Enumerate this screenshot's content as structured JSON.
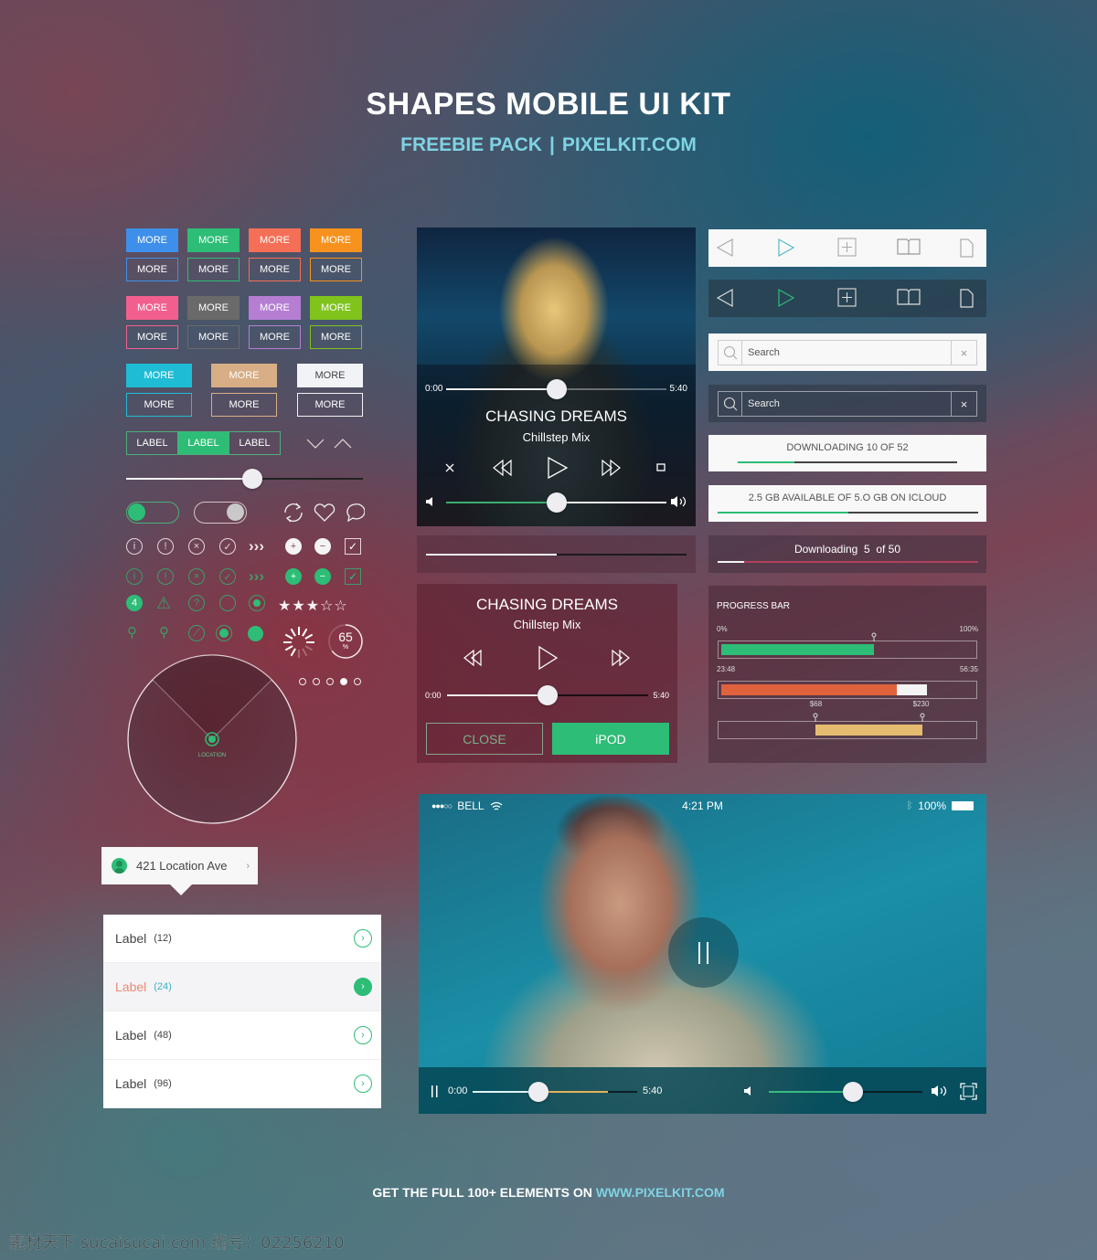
{
  "header": {
    "title": "SHAPES MOBILE UI KIT",
    "subtitle_left": "FREEBIE PACK",
    "subtitle_sep": "|",
    "subtitle_right": "PIXELKIT.COM"
  },
  "buttons": {
    "label": "MORE",
    "colors": [
      "#3d8fea",
      "#2dbd76",
      "#f56f56",
      "#f7921e",
      "#f25f8e",
      "#6a6a6a",
      "#b57ed3",
      "#7fc31c",
      "#1fbcd6",
      "#d7ae85",
      "#f2f3f6"
    ]
  },
  "segmented": {
    "items": [
      "LABEL",
      "LABEL",
      "LABEL"
    ],
    "active_index": 1
  },
  "slider": {
    "value": 0.5
  },
  "toggles": [
    {
      "state": "on"
    },
    {
      "state": "off"
    }
  ],
  "badge": {
    "count": "4"
  },
  "rating": {
    "value": 3,
    "max": 5
  },
  "percent_ring": {
    "value": "65",
    "unit": "%",
    "fraction": 0.65
  },
  "pagination": {
    "pages": 5,
    "active": 4
  },
  "radar": {
    "label": "LOCATION"
  },
  "location_tooltip": {
    "text": "421 Location Ave"
  },
  "list": {
    "items": [
      {
        "label": "Label",
        "count": "(12)",
        "active": false
      },
      {
        "label": "Label",
        "count": "(24)",
        "active": true
      },
      {
        "label": "Label",
        "count": "(48)",
        "active": false
      },
      {
        "label": "Label",
        "count": "(96)",
        "active": false
      }
    ]
  },
  "player_photo": {
    "time_start": "0:00",
    "time_end": "5:40",
    "progress": 0.5,
    "title": "CHASING DREAMS",
    "subtitle": "Chillstep Mix",
    "volume": 0.5
  },
  "simple_progress": {
    "value": 0.5
  },
  "player_compact": {
    "title": "CHASING DREAMS",
    "subtitle": "Chillstep Mix",
    "time_start": "0:00",
    "time_end": "5:40",
    "progress": 0.5,
    "close_label": "CLOSE",
    "ipod_label": "iPOD"
  },
  "search": {
    "placeholder": "Search"
  },
  "downloads": {
    "light": {
      "text": "DOWNLOADING 10 OF 52",
      "progress": 0.26
    },
    "icloud": {
      "text": "2.5 GB AVAILABLE OF 5.O GB ON ICLOUD",
      "progress": 0.5
    },
    "dark": {
      "text": "Downloading  5  of 50",
      "progress": 0.1
    }
  },
  "progress_panel": {
    "title": "PROGRESS BAR",
    "bar1": {
      "min_label": "0%",
      "max_label": "100%",
      "value": 0.6
    },
    "bar2": {
      "min_label": "23:48",
      "max_label": "56:35",
      "value": 0.69,
      "buffer": 0.81
    },
    "bar3": {
      "low_label": "$68",
      "high_label": "$230",
      "low": 0.37,
      "high": 0.79
    }
  },
  "video": {
    "status": {
      "signal": "●●●○○",
      "carrier": "BELL",
      "time": "4:21 PM",
      "battery": "100%"
    },
    "time_start": "0:00",
    "time_end": "5:40",
    "progress": 0.4,
    "buffer": 0.82,
    "volume": 0.55
  },
  "footer": {
    "text": "GET THE FULL 100+ ELEMENTS ON ",
    "link": "WWW.PIXELKIT.COM"
  },
  "watermark": "素材天下 sucaisucai.com  编号：02256210"
}
